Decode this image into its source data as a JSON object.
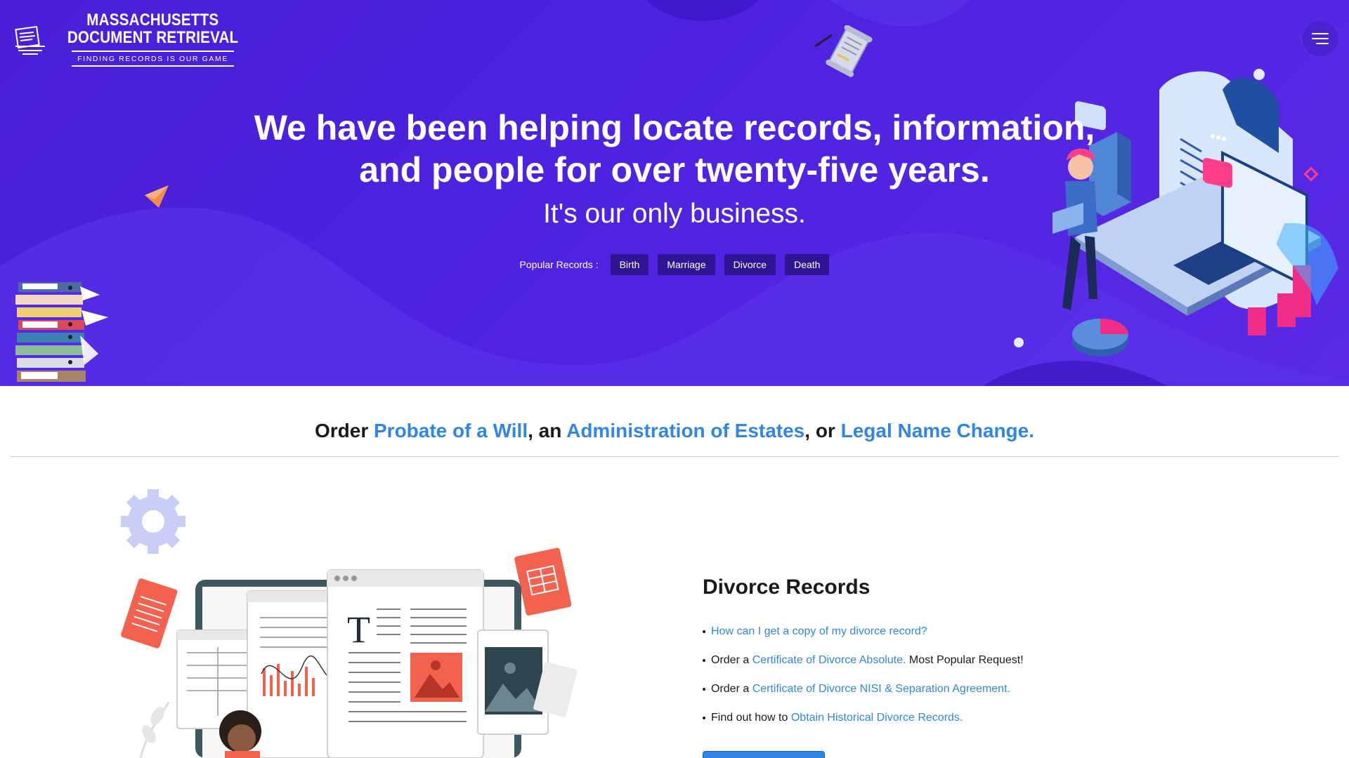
{
  "header": {
    "logo_line1": "MASSACHUSETTS",
    "logo_line2": "DOCUMENT RETRIEVAL",
    "logo_tagline": "FINDING RECORDS IS OUR GAME",
    "menu_icon": "hamburger-icon"
  },
  "hero": {
    "title_line1": "We have been helping locate records, information,",
    "title_line2": "and people for over twenty-five years.",
    "subtitle": "It's our only business.",
    "popular_label": "Popular Records :",
    "popular_records": [
      "Birth",
      "Marriage",
      "Divorce",
      "Death"
    ]
  },
  "order": {
    "prefix": "Order ",
    "link1": "Probate of a Will",
    "sep1": ", an ",
    "link2": "Administration of Estates",
    "sep2": ", or ",
    "link3": "Legal Name Change."
  },
  "divorce": {
    "title": "Divorce Records",
    "items": [
      {
        "before": "",
        "link": "How can I get a copy of my divorce record?",
        "after": ""
      },
      {
        "before": "Order a ",
        "link": "Certificate of Divorce Absolute.",
        "after": " Most Popular Request!"
      },
      {
        "before": "Order a ",
        "link": "Certificate of Divorce NISI & Separation Agreement.",
        "after": ""
      },
      {
        "before": "Find out how to ",
        "link": "Obtain Historical Divorce Records.",
        "after": ""
      }
    ]
  },
  "colors": {
    "hero_bg": "#4d22e0",
    "pill_bg": "#2f1596",
    "link": "#2f86e6",
    "accent_red": "#f2624f"
  }
}
